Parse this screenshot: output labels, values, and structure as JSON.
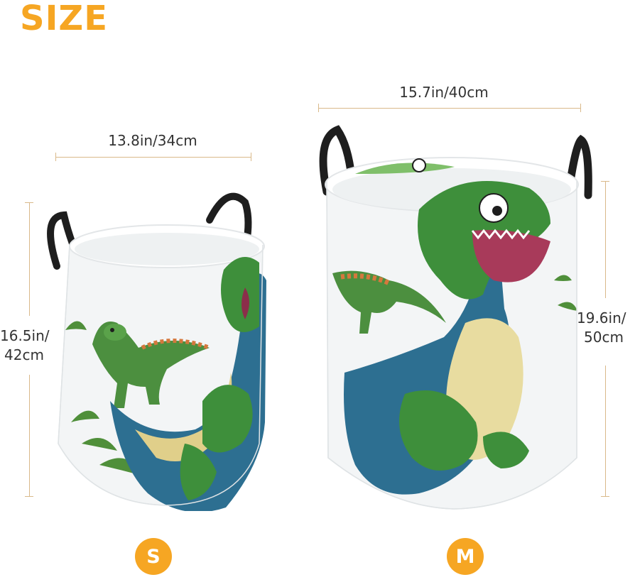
{
  "heading": "SIZE",
  "colors": {
    "accent": "#F6A623",
    "dimension_line": "#d9b98a",
    "basket_body": "#f3f5f6",
    "handle": "#1e1e1e",
    "dino_green": "#3e8f3b",
    "dino_blue": "#2d6f91",
    "dino_belly": "#e8dca0"
  },
  "small": {
    "width_label": "13.8in/34cm",
    "height_label_line1": "16.5in/",
    "height_label_line2": "42cm",
    "size_label": "S"
  },
  "medium": {
    "width_label": "15.7in/40cm",
    "height_label_line1": "19.6in/",
    "height_label_line2": "50cm",
    "size_label": "M"
  },
  "icons": {
    "basket_small": "dinosaur-print-laundry-basket-small",
    "basket_medium": "dinosaur-print-laundry-basket-medium"
  }
}
